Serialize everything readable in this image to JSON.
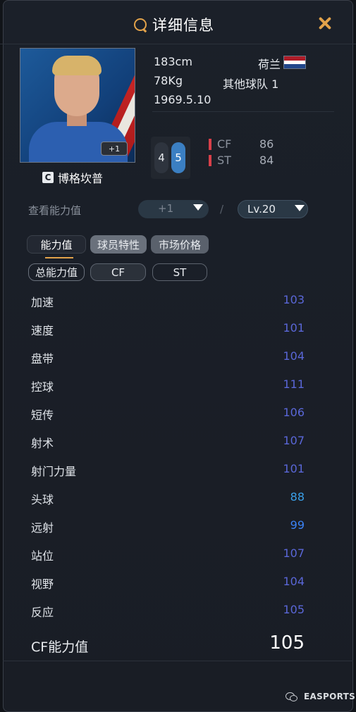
{
  "header": {
    "title": "详细信息",
    "icon": "search-icon"
  },
  "player": {
    "name": "博格坎普",
    "grade_icon_text": "C",
    "upgrade_badge": "+1",
    "height": "183cm",
    "weight": "78Kg",
    "birthdate": "1969.5.10",
    "nationality": "荷兰",
    "club": "其他球队 1",
    "weak_foot": "4",
    "strong_foot": "5",
    "positions": [
      {
        "name": "CF",
        "value": "86"
      },
      {
        "name": "ST",
        "value": "84"
      }
    ]
  },
  "controls": {
    "view_label": "查看能力值",
    "upgrade_select": "+1",
    "slash": "/",
    "level_select": "Lv.20"
  },
  "tabs": [
    {
      "label": "能力值",
      "active": true
    },
    {
      "label": "球员特性",
      "active": false
    },
    {
      "label": "市场价格",
      "active": false
    }
  ],
  "filters": [
    {
      "label": "总能力值"
    },
    {
      "label": "CF"
    },
    {
      "label": "ST"
    }
  ],
  "stats": [
    {
      "name": "加速",
      "value": "103",
      "color": "#5a67d8"
    },
    {
      "name": "速度",
      "value": "101",
      "color": "#5a67d8"
    },
    {
      "name": "盘带",
      "value": "104",
      "color": "#5a67d8"
    },
    {
      "name": "控球",
      "value": "111",
      "color": "#5a67d8"
    },
    {
      "name": "短传",
      "value": "106",
      "color": "#5a67d8"
    },
    {
      "name": "射术",
      "value": "107",
      "color": "#5a67d8"
    },
    {
      "name": "射门力量",
      "value": "101",
      "color": "#5a67d8"
    },
    {
      "name": "头球",
      "value": "88",
      "color": "#3aa0e8"
    },
    {
      "name": "远射",
      "value": "99",
      "color": "#3b82f6"
    },
    {
      "name": "站位",
      "value": "107",
      "color": "#5a67d8"
    },
    {
      "name": "视野",
      "value": "104",
      "color": "#5a67d8"
    },
    {
      "name": "反应",
      "value": "105",
      "color": "#5a67d8"
    }
  ],
  "total": {
    "label": "CF能力值",
    "value": "105"
  },
  "watermark": {
    "text": "EASPORTS"
  },
  "colors": {
    "accent": "#e2a24a",
    "flag": [
      "#ae1c28",
      "#ffffff",
      "#21468b"
    ],
    "position_bar": "#d8404a"
  }
}
